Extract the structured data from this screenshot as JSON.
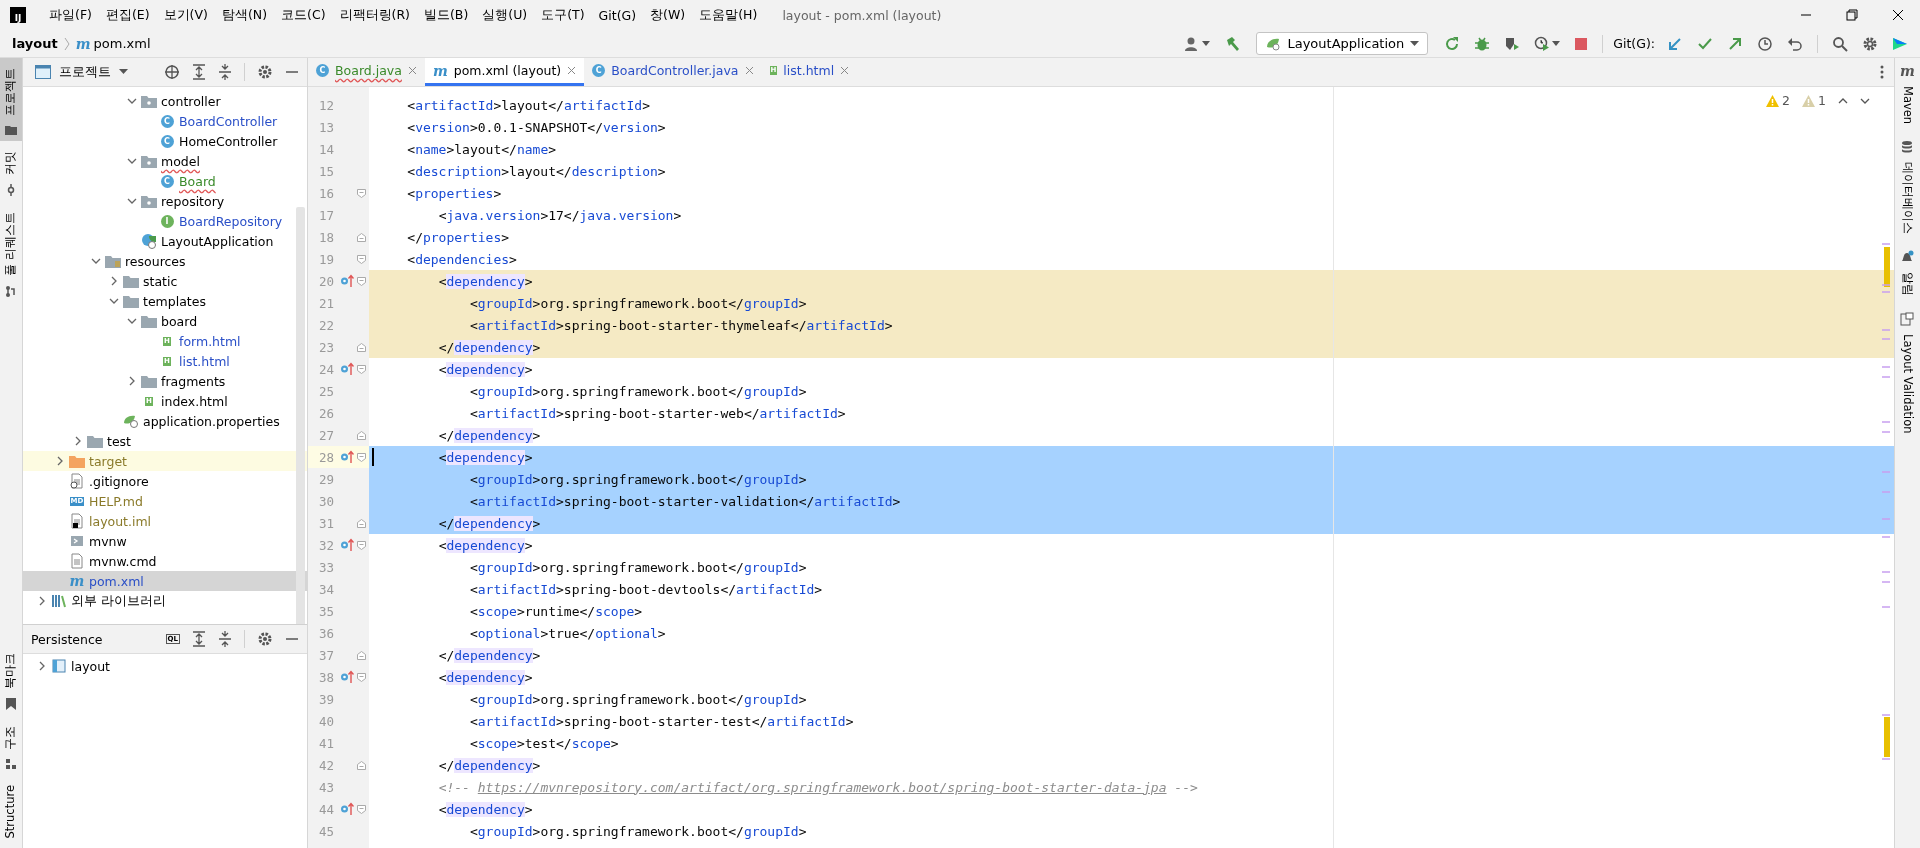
{
  "title_bar": {
    "logo": "IJ",
    "menu": [
      "파일(F)",
      "편집(E)",
      "보기(V)",
      "탐색(N)",
      "코드(C)",
      "리팩터링(R)",
      "빌드(B)",
      "실행(U)",
      "도구(T)",
      "Git(G)",
      "창(W)",
      "도움말(H)"
    ],
    "window_title": "layout - pom.xml (layout)"
  },
  "nav_bar": {
    "project": "layout",
    "file": "pom.xml",
    "file_badge": "m",
    "run_config": "LayoutApplication",
    "tools": [
      {
        "kind": "user",
        "caret": true
      },
      {
        "kind": "hammer",
        "caret": false
      }
    ],
    "run_tools": [
      {
        "kind": "rerun",
        "caret": false
      },
      {
        "kind": "debug",
        "caret": false
      },
      {
        "kind": "coverage",
        "caret": false
      },
      {
        "kind": "profile",
        "caret": true
      },
      {
        "kind": "stop",
        "caret": false
      }
    ],
    "git_label": "Git(G):",
    "git_tools": [
      {
        "kind": "update"
      },
      {
        "kind": "commit"
      },
      {
        "kind": "push"
      },
      {
        "kind": "history"
      },
      {
        "kind": "rollback"
      }
    ],
    "misc_tools": [
      {
        "kind": "search"
      },
      {
        "kind": "settings"
      },
      {
        "kind": "logo"
      }
    ]
  },
  "left_strip": {
    "top": [
      {
        "label": "프로젝트",
        "kind": "folder",
        "selected": true
      },
      {
        "label": "커밋",
        "kind": "commit",
        "selected": false
      },
      {
        "label": "풀 리퀘스트",
        "kind": "pull",
        "selected": false
      }
    ],
    "bottom": [
      {
        "label": "북마크",
        "kind": "bookmark",
        "selected": false
      },
      {
        "label": "구조",
        "kind": "structure",
        "selected": false
      },
      {
        "label": "Structure",
        "kind": "text",
        "selected": false
      }
    ]
  },
  "project_panel": {
    "title": "프로젝트",
    "tree": [
      {
        "children": [
          {
            "children": [
              {
                "children": [
                  {
                    "children": [
                      {
                        "children": [
                          {
                            "name": "controller",
                            "kind": "package",
                            "expanded": true,
                            "color": "#000000",
                            "error": false,
                            "selected": false,
                            "highlighted": false,
                            "children": [
                              {
                                "name": "BoardController",
                                "kind": "class",
                                "badge": "C",
                                "color": "#2a4fc7",
                                "error": false,
                                "selected": false,
                                "highlighted": false
                              },
                              {
                                "name": "HomeController",
                                "kind": "class",
                                "badge": "C",
                                "color": "#000000",
                                "error": false,
                                "selected": false,
                                "highlighted": false
                              }
                            ]
                          },
                          {
                            "name": "model",
                            "kind": "package",
                            "expanded": true,
                            "color": "#000000",
                            "error": true,
                            "selected": false,
                            "highlighted": false,
                            "children": [
                              {
                                "name": "Board",
                                "kind": "class",
                                "badge": "C",
                                "color": "#3a8a2a",
                                "error": true,
                                "selected": false,
                                "highlighted": false
                              }
                            ]
                          },
                          {
                            "name": "repository",
                            "kind": "package",
                            "expanded": true,
                            "color": "#000000",
                            "error": false,
                            "selected": false,
                            "highlighted": false,
                            "children": [
                              {
                                "name": "BoardRepository",
                                "kind": "interface",
                                "badge": "I",
                                "color": "#2a4fc7",
                                "error": false,
                                "selected": false,
                                "highlighted": false
                              }
                            ]
                          },
                          {
                            "name": "LayoutApplication",
                            "kind": "spring",
                            "color": "#000000",
                            "error": false,
                            "selected": false,
                            "highlighted": false
                          }
                        ]
                      }
                    ]
                  },
                  {
                    "name": "resources",
                    "kind": "resources",
                    "expanded": true,
                    "color": "#000000",
                    "error": false,
                    "selected": false,
                    "highlighted": false,
                    "children": [
                      {
                        "name": "static",
                        "kind": "folder",
                        "expanded": false,
                        "color": "#000000",
                        "error": false,
                        "selected": false,
                        "highlighted": false
                      },
                      {
                        "name": "templates",
                        "kind": "folder",
                        "expanded": true,
                        "color": "#000000",
                        "error": false,
                        "selected": false,
                        "highlighted": false,
                        "children": [
                          {
                            "name": "board",
                            "kind": "folder",
                            "expanded": true,
                            "color": "#000000",
                            "error": false,
                            "selected": false,
                            "highlighted": false,
                            "children": [
                              {
                                "name": "form.html",
                                "kind": "html",
                                "badge": "H",
                                "color": "#2a4fc7",
                                "error": false,
                                "selected": false,
                                "highlighted": false
                              },
                              {
                                "name": "list.html",
                                "kind": "html",
                                "badge": "H",
                                "color": "#2a4fc7",
                                "error": false,
                                "selected": false,
                                "highlighted": false
                              }
                            ]
                          },
                          {
                            "name": "fragments",
                            "kind": "folder",
                            "expanded": false,
                            "color": "#000000",
                            "error": false,
                            "selected": false,
                            "highlighted": false
                          },
                          {
                            "name": "index.html",
                            "kind": "html",
                            "badge": "H",
                            "color": "#000000",
                            "error": false,
                            "selected": false,
                            "highlighted": false
                          }
                        ]
                      },
                      {
                        "name": "application.properties",
                        "kind": "properties",
                        "color": "#000000",
                        "error": false,
                        "selected": false,
                        "highlighted": false
                      }
                    ]
                  }
                ]
              },
              {
                "name": "test",
                "kind": "folder",
                "expanded": false,
                "color": "#000000",
                "error": false,
                "selected": false,
                "highlighted": false
              }
            ]
          },
          {
            "name": "target",
            "kind": "excluded",
            "expanded": false,
            "color": "#8a7a2a",
            "error": false,
            "selected": false,
            "highlighted": true
          },
          {
            "name": ".gitignore",
            "kind": "ignore",
            "color": "#000000",
            "error": false,
            "selected": false,
            "highlighted": false
          },
          {
            "name": "HELP.md",
            "kind": "markdown",
            "badge": "MD",
            "color": "#8a7a2a",
            "error": false,
            "selected": false,
            "highlighted": false
          },
          {
            "name": "layout.iml",
            "kind": "iml",
            "color": "#8a7a2a",
            "error": false,
            "selected": false,
            "highlighted": false
          },
          {
            "name": "mvnw",
            "kind": "shell",
            "color": "#000000",
            "error": false,
            "selected": false,
            "highlighted": false
          },
          {
            "name": "mvnw.cmd",
            "kind": "text",
            "color": "#000000",
            "error": false,
            "selected": false,
            "highlighted": false
          },
          {
            "name": "pom.xml",
            "kind": "maven",
            "badge": "m",
            "color": "#2a4fc7",
            "error": false,
            "selected": true,
            "highlighted": false
          }
        ]
      },
      {
        "name": "외부 라이브러리",
        "kind": "library",
        "expanded": false,
        "error": false,
        "selected": false,
        "highlighted": false
      }
    ]
  },
  "persistence_panel": {
    "title": "Persistence",
    "ql_badge": "QL",
    "tree": [
      {
        "name": "layout",
        "expanded": false
      }
    ]
  },
  "editor_tabs": [
    {
      "label": "Board.java",
      "kind": "class",
      "badge": "C",
      "color": "#3a8a2a",
      "error": true,
      "selected": false
    },
    {
      "label": "pom.xml (layout)",
      "kind": "maven",
      "badge": "m",
      "color": "#000000",
      "error": false,
      "selected": true
    },
    {
      "label": "BoardController.java",
      "kind": "class",
      "badge": "C",
      "color": "#2a4fc7",
      "error": false,
      "selected": false
    },
    {
      "label": "list.html",
      "kind": "html",
      "badge": "H",
      "color": "#2a4fc7",
      "error": false,
      "selected": false
    }
  ],
  "inspections": [
    {
      "kind": "warning",
      "count": "2"
    },
    {
      "kind": "weak-warning",
      "count": "1"
    }
  ],
  "code": [
    {
      "n": "12",
      "text": "    <artifactId>layout</artifactId>",
      "changed": false,
      "selected": false,
      "gutter_icon": false,
      "fold_start": false,
      "fold_end": false,
      "tag_highlight": false,
      "caret": false
    },
    {
      "n": "13",
      "text": "    <version>0.0.1-SNAPSHOT</version>",
      "changed": false,
      "selected": false,
      "gutter_icon": false,
      "fold_start": false,
      "fold_end": false,
      "tag_highlight": false,
      "caret": false
    },
    {
      "n": "14",
      "text": "    <name>layout</name>",
      "changed": false,
      "selected": false,
      "gutter_icon": false,
      "fold_start": false,
      "fold_end": false,
      "tag_highlight": false,
      "caret": false
    },
    {
      "n": "15",
      "text": "    <description>layout</description>",
      "changed": false,
      "selected": false,
      "gutter_icon": false,
      "fold_start": false,
      "fold_end": false,
      "tag_highlight": false,
      "caret": false
    },
    {
      "n": "16",
      "text": "    <properties>",
      "changed": false,
      "selected": false,
      "gutter_icon": false,
      "fold_start": true,
      "fold_end": false,
      "tag_highlight": false,
      "caret": false
    },
    {
      "n": "17",
      "text": "        <java.version>17</java.version>",
      "changed": false,
      "selected": false,
      "gutter_icon": false,
      "fold_start": false,
      "fold_end": false,
      "tag_highlight": false,
      "caret": false
    },
    {
      "n": "18",
      "text": "    </properties>",
      "changed": false,
      "selected": false,
      "gutter_icon": false,
      "fold_start": false,
      "fold_end": true,
      "tag_highlight": false,
      "caret": false
    },
    {
      "n": "19",
      "text": "    <dependencies>",
      "changed": false,
      "selected": false,
      "gutter_icon": false,
      "fold_start": true,
      "fold_end": false,
      "tag_highlight": false,
      "caret": false
    },
    {
      "n": "20",
      "text": "        <dependency>",
      "changed": true,
      "selected": false,
      "gutter_icon": true,
      "fold_start": true,
      "fold_end": false,
      "tag_highlight": true,
      "caret": false
    },
    {
      "n": "21",
      "text": "            <groupId>org.springframework.boot</groupId>",
      "changed": true,
      "selected": false,
      "gutter_icon": false,
      "fold_start": false,
      "fold_end": false,
      "tag_highlight": false,
      "caret": false
    },
    {
      "n": "22",
      "text": "            <artifactId>spring-boot-starter-thymeleaf</artifactId>",
      "changed": true,
      "selected": false,
      "gutter_icon": false,
      "fold_start": false,
      "fold_end": false,
      "tag_highlight": false,
      "caret": false
    },
    {
      "n": "23",
      "text": "        </dependency>",
      "changed": true,
      "selected": false,
      "gutter_icon": false,
      "fold_start": false,
      "fold_end": true,
      "tag_highlight": true,
      "caret": false
    },
    {
      "n": "24",
      "text": "        <dependency>",
      "changed": false,
      "selected": false,
      "gutter_icon": true,
      "fold_start": true,
      "fold_end": false,
      "tag_highlight": true,
      "caret": false
    },
    {
      "n": "25",
      "text": "            <groupId>org.springframework.boot</groupId>",
      "changed": false,
      "selected": false,
      "gutter_icon": false,
      "fold_start": false,
      "fold_end": false,
      "tag_highlight": false,
      "caret": false
    },
    {
      "n": "26",
      "text": "            <artifactId>spring-boot-starter-web</artifactId>",
      "changed": false,
      "selected": false,
      "gutter_icon": false,
      "fold_start": false,
      "fold_end": false,
      "tag_highlight": false,
      "caret": false
    },
    {
      "n": "27",
      "text": "        </dependency>",
      "changed": false,
      "selected": false,
      "gutter_icon": false,
      "fold_start": false,
      "fold_end": true,
      "tag_highlight": true,
      "caret": false
    },
    {
      "n": "28",
      "text": "        <dependency>",
      "changed": false,
      "selected": true,
      "gutter_icon": true,
      "fold_start": true,
      "fold_end": false,
      "tag_highlight": true,
      "caret": true
    },
    {
      "n": "29",
      "text": "            <groupId>org.springframework.boot</groupId>",
      "changed": false,
      "selected": true,
      "gutter_icon": false,
      "fold_start": false,
      "fold_end": false,
      "tag_highlight": false,
      "caret": false
    },
    {
      "n": "30",
      "text": "            <artifactId>spring-boot-starter-validation</artifactId>",
      "changed": false,
      "selected": true,
      "gutter_icon": false,
      "fold_start": false,
      "fold_end": false,
      "tag_highlight": false,
      "caret": false
    },
    {
      "n": "31",
      "text": "        </dependency>",
      "changed": false,
      "selected": true,
      "gutter_icon": false,
      "fold_start": false,
      "fold_end": true,
      "tag_highlight": true,
      "caret": false
    },
    {
      "n": "32",
      "text": "        <dependency>",
      "changed": false,
      "selected": false,
      "gutter_icon": true,
      "fold_start": true,
      "fold_end": false,
      "tag_highlight": true,
      "caret": false
    },
    {
      "n": "33",
      "text": "            <groupId>org.springframework.boot</groupId>",
      "changed": false,
      "selected": false,
      "gutter_icon": false,
      "fold_start": false,
      "fold_end": false,
      "tag_highlight": false,
      "caret": false
    },
    {
      "n": "34",
      "text": "            <artifactId>spring-boot-devtools</artifactId>",
      "changed": false,
      "selected": false,
      "gutter_icon": false,
      "fold_start": false,
      "fold_end": false,
      "tag_highlight": false,
      "caret": false
    },
    {
      "n": "35",
      "text": "            <scope>runtime</scope>",
      "changed": false,
      "selected": false,
      "gutter_icon": false,
      "fold_start": false,
      "fold_end": false,
      "tag_highlight": false,
      "caret": false
    },
    {
      "n": "36",
      "text": "            <optional>true</optional>",
      "changed": false,
      "selected": false,
      "gutter_icon": false,
      "fold_start": false,
      "fold_end": false,
      "tag_highlight": false,
      "caret": false
    },
    {
      "n": "37",
      "text": "        </dependency>",
      "changed": false,
      "selected": false,
      "gutter_icon": false,
      "fold_start": false,
      "fold_end": true,
      "tag_highlight": true,
      "caret": false
    },
    {
      "n": "38",
      "text": "        <dependency>",
      "changed": false,
      "selected": false,
      "gutter_icon": true,
      "fold_start": true,
      "fold_end": false,
      "tag_highlight": true,
      "caret": false
    },
    {
      "n": "39",
      "text": "            <groupId>org.springframework.boot</groupId>",
      "changed": false,
      "selected": false,
      "gutter_icon": false,
      "fold_start": false,
      "fold_end": false,
      "tag_highlight": false,
      "caret": false
    },
    {
      "n": "40",
      "text": "            <artifactId>spring-boot-starter-test</artifactId>",
      "changed": false,
      "selected": false,
      "gutter_icon": false,
      "fold_start": false,
      "fold_end": false,
      "tag_highlight": false,
      "caret": false
    },
    {
      "n": "41",
      "text": "            <scope>test</scope>",
      "changed": false,
      "selected": false,
      "gutter_icon": false,
      "fold_start": false,
      "fold_end": false,
      "tag_highlight": false,
      "caret": false
    },
    {
      "n": "42",
      "text": "        </dependency>",
      "changed": false,
      "selected": false,
      "gutter_icon": false,
      "fold_start": false,
      "fold_end": true,
      "tag_highlight": true,
      "caret": false
    },
    {
      "n": "43",
      "text": "        <!-- https://mvnrepository.com/artifact/org.springframework.boot/spring-boot-starter-data-jpa -->",
      "changed": false,
      "selected": false,
      "gutter_icon": false,
      "fold_start": false,
      "fold_end": false,
      "caret": false
    },
    {
      "n": "44",
      "text": "        <dependency>",
      "changed": false,
      "selected": false,
      "gutter_icon": true,
      "fold_start": true,
      "fold_end": false,
      "tag_highlight": true,
      "caret": false
    },
    {
      "n": "45",
      "text": "            <groupId>org.springframework.boot</groupId>",
      "changed": false,
      "selected": false,
      "gutter_icon": false,
      "fold_start": false,
      "fold_end": false,
      "tag_highlight": false,
      "caret": false
    }
  ],
  "right_strip": [
    {
      "label": "Maven",
      "kind": "maven",
      "badge": "m"
    },
    {
      "label": "데이터베이스",
      "kind": "database"
    },
    {
      "label": "알림",
      "kind": "bell"
    },
    {
      "label": "Layout Validation",
      "kind": "layout"
    }
  ]
}
